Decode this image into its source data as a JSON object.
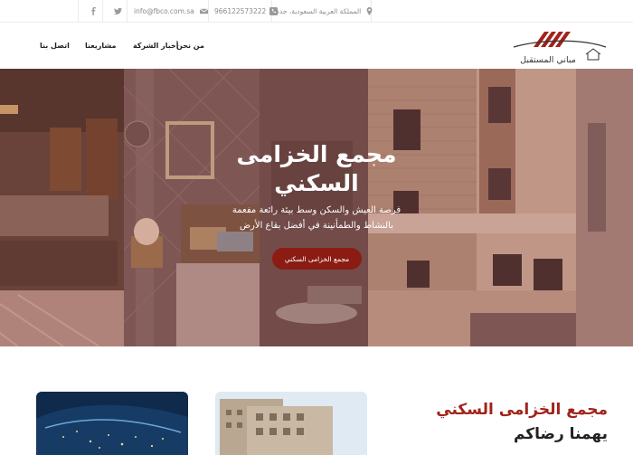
{
  "topbar": {
    "address": "المملكة العربية السعودية، جدة",
    "phone": "966122573222",
    "email": "info@fbco.com.sa",
    "icons": [
      "map-marker-icon",
      "phone-icon",
      "envelope-icon",
      "twitter-icon",
      "facebook-icon"
    ]
  },
  "brand": {
    "logo_text": "مباني المستقبل",
    "colors": {
      "accent": "#8a1c14",
      "logo_red": "#a1231a",
      "text_dark": "#222222"
    }
  },
  "nav": {
    "about": "من نحن",
    "news": "أخبار الشركة",
    "projects": "مشاريعنا",
    "contact": "اتصل بنا"
  },
  "hero": {
    "title_line1": "مجمع الخزامى",
    "title_line2": "السكني",
    "subtitle_line1": "فرصة العيش والسكن وسط بيئة رائعة مفعمة",
    "subtitle_line2": "بالنشاط والطمأنينة في أفضل بقاع الأرض",
    "button_label": "مجمع الخزامى السكني"
  },
  "section": {
    "title": "مجمع الخزامى السكني",
    "subtitle": "يهمنا رضاكم"
  }
}
